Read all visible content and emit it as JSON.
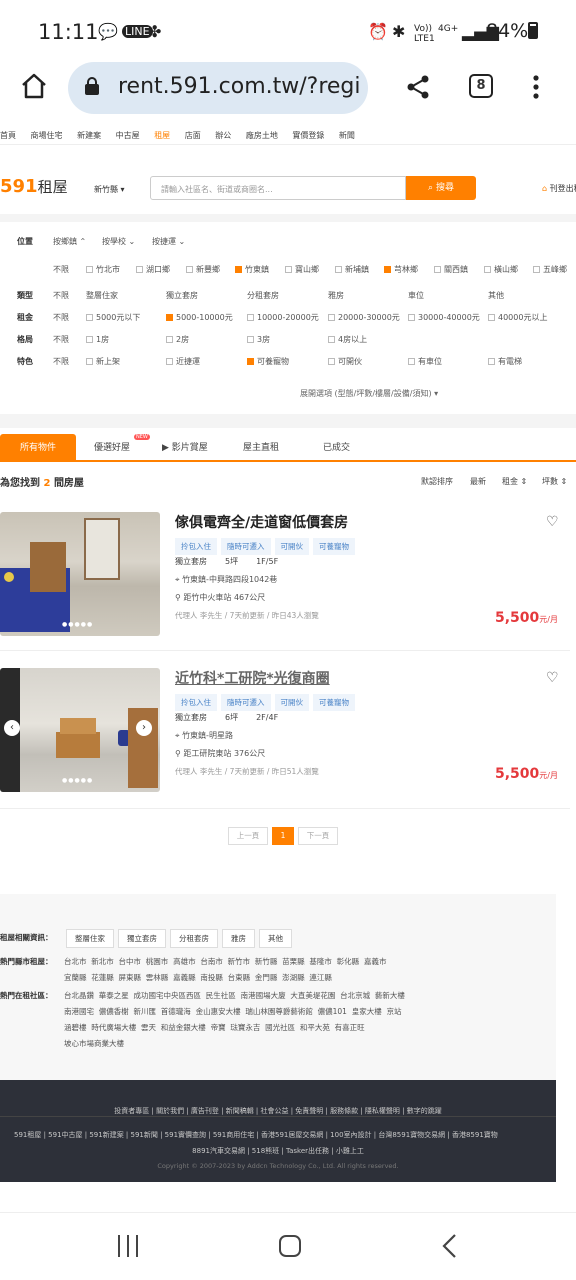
{
  "status_bar": {
    "time": "11:11",
    "battery": "84%",
    "network": "4G+"
  },
  "browser": {
    "url": "rent.591.com.tw/?regi",
    "tab_count": "8"
  },
  "top_nav": [
    "首頁",
    "商場住宅",
    "新建案",
    "中古屋",
    "租屋",
    "店面",
    "辦公",
    "廠房土地",
    "實價登錄",
    "新聞"
  ],
  "header": {
    "logo_num": "591",
    "logo_text": "租屋",
    "city": "新竹縣 ▾",
    "search_placeholder": "請輸入社區名、街道或商圈名...",
    "search_button": "搜尋",
    "post_label": "刊登出租"
  },
  "filters": {
    "position_label": "位置",
    "position_opts": [
      "按鄉鎮",
      "按學校",
      "按捷運"
    ],
    "towns": [
      "不限",
      "竹北市",
      "湖口鄉",
      "新豐鄉",
      "竹東鎮",
      "寶山鄉",
      "新埔鎮",
      "芎林鄉",
      "關西鎮",
      "橫山鄉",
      "五峰鄉"
    ],
    "type_label": "類型",
    "types": [
      "不限",
      "整層住家",
      "獨立套房",
      "分租套房",
      "雅房",
      "車位",
      "其他"
    ],
    "rent_label": "租金",
    "rents": [
      "不限",
      "5000元以下",
      "5000-10000元",
      "10000-20000元",
      "20000-30000元",
      "30000-40000元",
      "40000元以上"
    ],
    "layout_label": "格局",
    "layouts": [
      "不限",
      "1房",
      "2房",
      "3房",
      "4房以上"
    ],
    "feature_label": "特色",
    "features": [
      "不限",
      "新上架",
      "近捷運",
      "可養寵物",
      "可開伙",
      "有車位",
      "有電梯"
    ],
    "more": "展開選項 (型態/坪數/樓層/設備/須知) ▾"
  },
  "result_tabs": [
    "所有物件",
    "優選好屋",
    "影片賞屋",
    "屋主直租",
    "已成交"
  ],
  "result_count_prefix": "為您找到",
  "result_count": "2",
  "result_count_suffix": "間房屋",
  "sort": [
    "默認排序",
    "最新",
    "租金 ⇕",
    "坪數 ⇕"
  ],
  "listings": [
    {
      "title": "傢俱電齊全/走道窗低價套房",
      "tags": [
        "拎包入住",
        "隨時可遷入",
        "可開伙",
        "可養寵物"
      ],
      "kind": "獨立套房",
      "size": "5坪",
      "floor": "1F/5F",
      "address": "竹東鎮-中興路四段1042巷",
      "nearby": "距竹中火車站 467公尺",
      "agent": "代理人 李先生 / 7天前更新 / 昨日43人瀏覽",
      "price": "5,500",
      "unit": "元/月"
    },
    {
      "title": "近竹科*工研院*光復商圈",
      "tags": [
        "拎包入住",
        "隨時可遷入",
        "可開伙",
        "可養寵物"
      ],
      "kind": "獨立套房",
      "size": "6坪",
      "floor": "2F/4F",
      "address": "竹東鎮-明星路",
      "nearby": "距工研院東站 376公尺",
      "agent": "代理人 李先生 / 7天前更新 / 昨日51人瀏覽",
      "price": "5,500",
      "unit": "元/月"
    }
  ],
  "pager": {
    "prev": "上一頁",
    "current": "1",
    "next": "下一頁"
  },
  "related": {
    "label1": "租屋相關資訊：",
    "chips": [
      "整層住家",
      "獨立套房",
      "分租套房",
      "雅房",
      "其他"
    ],
    "label2": "熱門縣市租屋：",
    "cities_line1": "台北市  新北市  台中市  桃園市  高雄市  台南市  新竹市  新竹縣  苗栗縣  基隆市  彰化縣  嘉義市",
    "cities_line2": "宜蘭縣  花蓮縣  屏東縣  雲林縣  嘉義縣  南投縣  台東縣  金門縣  澎湖縣  連江縣",
    "label3": "熱門在租社區：",
    "comm_line1": "台北晶鑽  華泰之星  成功國宅中央區西區  民生社區  南港國場大廈  大直美堤花園  台北京城  藝新大樓",
    "comm_line2": "南港國宅  儂儂香榭  新川匯  首德瓏海  金山惠安大樓  瑞山林園尊爵藝術館  儂儂101  皇家大樓  京站",
    "comm_line3": "涵碧樓  時代廣場大樓  雲天  和益金銀大樓  帝寶  琺寶永吉  國光社區  和平大苑  有喜正旺",
    "comm_line4": "坡心市場商業大樓"
  },
  "footer": {
    "links1": "投資者專區 | 關於我們 | 廣告刊登 | 新聞稿輯 | 社會公益 | 免責聲明 | 服務條款 | 隱私權聲明 | 數字的跳躍",
    "links2": "591租屋 | 591中古屋 | 591新建案 | 591新聞 | 591實價查詢 | 591商用住宅 | 香港591居屋交易網 | 100室內設計 | 台灣8591寶物交易網 | 香港8591寶物",
    "links3": "8891汽車交易網 | 518熊班 | Tasker出任務 | 小雞上工",
    "copy": "Copyright © 2007-2023 by Addcn Technology Co., Ltd. All rights reserved."
  }
}
